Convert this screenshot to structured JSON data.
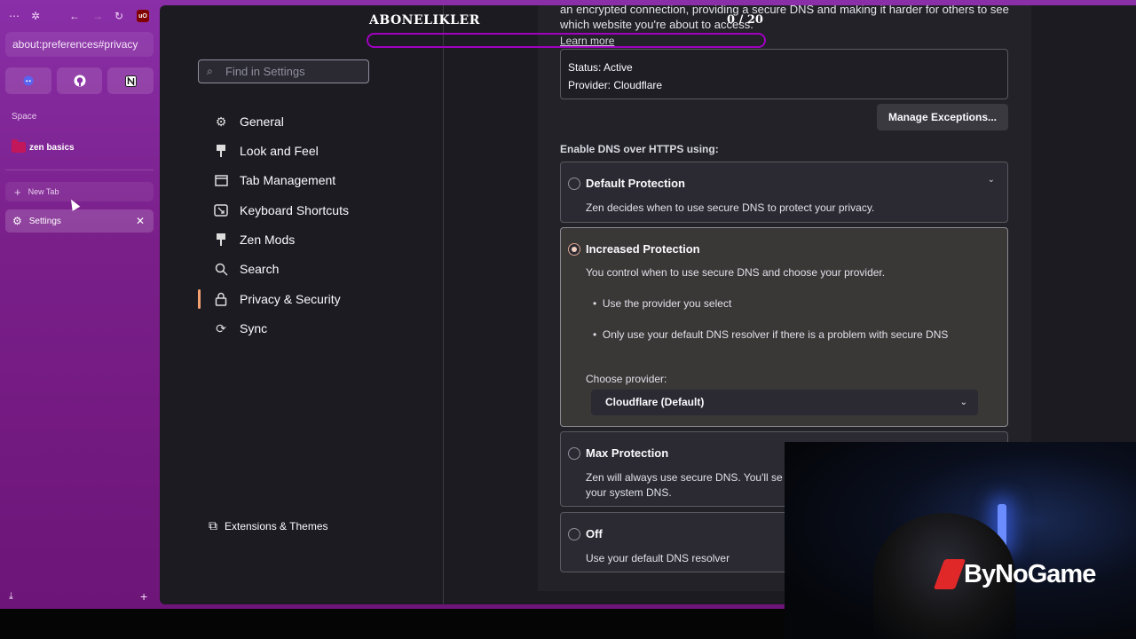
{
  "browser": {
    "url": "about:preferences#privacy",
    "space_label": "Space",
    "folder_label": "zen basics",
    "new_tab_label": "New Tab",
    "active_tab_label": "Settings",
    "ublock_badge": "uO"
  },
  "settings": {
    "search_placeholder": "Find in Settings",
    "nav": [
      {
        "label": "General",
        "icon": "gear-icon"
      },
      {
        "label": "Look and Feel",
        "icon": "brush-icon"
      },
      {
        "label": "Tab Management",
        "icon": "tab-icon"
      },
      {
        "label": "Keyboard Shortcuts",
        "icon": "keyboard-icon"
      },
      {
        "label": "Zen Mods",
        "icon": "brush-icon"
      },
      {
        "label": "Search",
        "icon": "search-icon"
      },
      {
        "label": "Privacy & Security",
        "icon": "lock-icon",
        "active": true
      },
      {
        "label": "Sync",
        "icon": "sync-icon"
      }
    ],
    "extensions_label": "Extensions & Themes"
  },
  "dns": {
    "intro": "an encrypted connection, providing a secure DNS and making it harder for others to see which website you're about to access.",
    "learn_more": "Learn more",
    "status": "Status: Active",
    "provider": "Provider: Cloudflare",
    "manage_exceptions": "Manage Exceptions...",
    "enable_label": "Enable DNS over HTTPS using:",
    "options": {
      "default": {
        "title": "Default Protection",
        "desc": "Zen decides when to use secure DNS to protect your privacy."
      },
      "increased": {
        "title": "Increased Protection",
        "desc": "You control when to use secure DNS and choose your provider.",
        "bullet1": "Use the provider you select",
        "bullet2": "Only use your default DNS resolver if there is a problem with secure DNS",
        "choose_label": "Choose provider:",
        "selected_provider": "Cloudflare (Default)"
      },
      "max": {
        "title": "Max Protection",
        "desc": "Zen will always use secure DNS. You'll se",
        "desc2": "your system DNS."
      },
      "off": {
        "title": "Off",
        "desc": "Use your default DNS resolver"
      }
    },
    "selected": "increased"
  },
  "overlay": {
    "subscribers_label": "ABONELIKLER",
    "counter": "0 / 20",
    "progress": 0,
    "brand": "ByNoGame",
    "progress_color": "#a000c0"
  }
}
